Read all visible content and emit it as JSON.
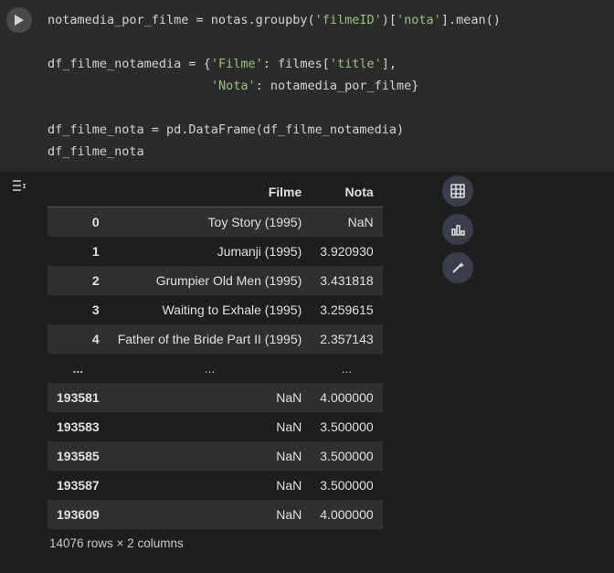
{
  "code": {
    "lines": [
      [
        [
          "w",
          "notamedia_por_filme = notas.groupby("
        ],
        [
          "s",
          "'filmeID'"
        ],
        [
          "w",
          ")["
        ],
        [
          "s",
          "'nota'"
        ],
        [
          "w",
          "].mean()"
        ]
      ],
      [
        [
          "w",
          ""
        ]
      ],
      [
        [
          "w",
          "df_filme_notamedia = {"
        ],
        [
          "s",
          "'Filme'"
        ],
        [
          "w",
          ": filmes["
        ],
        [
          "s",
          "'title'"
        ],
        [
          "w",
          "],"
        ]
      ],
      [
        [
          "w",
          "                      "
        ],
        [
          "s",
          "'Nota'"
        ],
        [
          "w",
          ": notamedia_por_filme}"
        ]
      ],
      [
        [
          "w",
          ""
        ]
      ],
      [
        [
          "w",
          "df_filme_nota = pd.DataFrame(df_filme_notamedia)"
        ]
      ],
      [
        [
          "w",
          "df_filme_nota"
        ]
      ]
    ]
  },
  "dataframe": {
    "columns": [
      "Filme",
      "Nota"
    ],
    "rows": [
      {
        "idx": "0",
        "filme": "Toy Story (1995)",
        "nota": "NaN"
      },
      {
        "idx": "1",
        "filme": "Jumanji (1995)",
        "nota": "3.920930"
      },
      {
        "idx": "2",
        "filme": "Grumpier Old Men (1995)",
        "nota": "3.431818"
      },
      {
        "idx": "3",
        "filme": "Waiting to Exhale (1995)",
        "nota": "3.259615"
      },
      {
        "idx": "4",
        "filme": "Father of the Bride Part II (1995)",
        "nota": "2.357143"
      },
      {
        "idx": "...",
        "filme": "...",
        "nota": "...",
        "ellipsis": true
      },
      {
        "idx": "193581",
        "filme": "NaN",
        "nota": "4.000000"
      },
      {
        "idx": "193583",
        "filme": "NaN",
        "nota": "3.500000"
      },
      {
        "idx": "193585",
        "filme": "NaN",
        "nota": "3.500000"
      },
      {
        "idx": "193587",
        "filme": "NaN",
        "nota": "3.500000"
      },
      {
        "idx": "193609",
        "filme": "NaN",
        "nota": "4.000000"
      }
    ],
    "shape_text": "14076 rows × 2 columns"
  },
  "icons": {
    "run": "run-icon",
    "toggle_output": "toggle-output-icon",
    "table_view": "table-icon",
    "chart_view": "chart-icon",
    "magic": "magic-wand-icon"
  }
}
